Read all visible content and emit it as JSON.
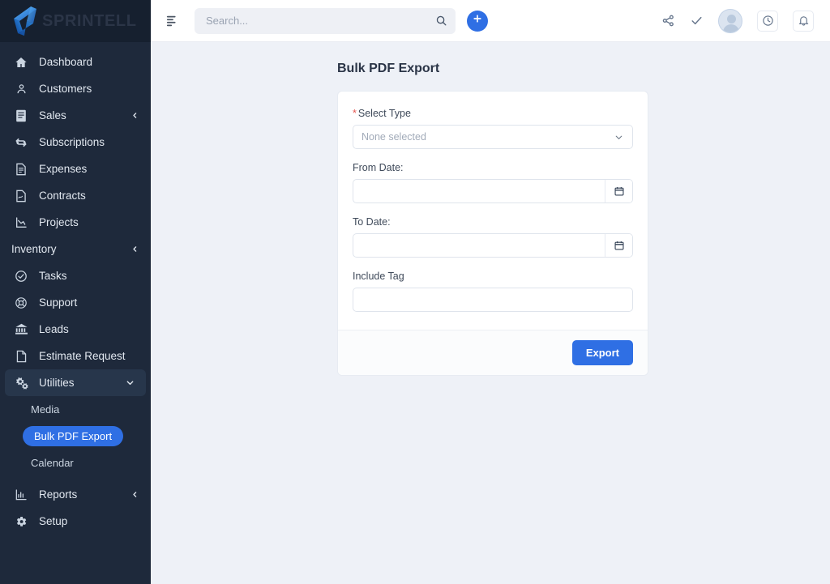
{
  "brand": {
    "name": "SPRINTELL",
    "logo_icon": "sprintell-s-logo-icon"
  },
  "sidebar": {
    "items": [
      {
        "label": "Dashboard",
        "icon": "home-icon",
        "has_icon": true,
        "chevron": ""
      },
      {
        "label": "Customers",
        "icon": "user-icon",
        "has_icon": true,
        "chevron": ""
      },
      {
        "label": "Sales",
        "icon": "receipt-icon",
        "has_icon": true,
        "chevron": "left"
      },
      {
        "label": "Subscriptions",
        "icon": "refresh-cycle-icon",
        "has_icon": true,
        "chevron": ""
      },
      {
        "label": "Expenses",
        "icon": "document-icon",
        "has_icon": true,
        "chevron": ""
      },
      {
        "label": "Contracts",
        "icon": "contract-icon",
        "has_icon": true,
        "chevron": ""
      },
      {
        "label": "Projects",
        "icon": "chart-decline-icon",
        "has_icon": true,
        "chevron": ""
      },
      {
        "label": "Inventory",
        "icon": "",
        "has_icon": false,
        "chevron": "left"
      },
      {
        "label": "Tasks",
        "icon": "check-circle-icon",
        "has_icon": true,
        "chevron": ""
      },
      {
        "label": "Support",
        "icon": "life-ring-icon",
        "has_icon": true,
        "chevron": ""
      },
      {
        "label": "Leads",
        "icon": "bank-icon",
        "has_icon": true,
        "chevron": ""
      },
      {
        "label": "Estimate Request",
        "icon": "file-icon",
        "has_icon": true,
        "chevron": ""
      }
    ],
    "utilities": {
      "label": "Utilities",
      "icon": "gears-icon",
      "chevron": "down",
      "expanded": true,
      "children": [
        {
          "label": "Media",
          "active": false
        },
        {
          "label": "Bulk PDF Export",
          "active": true
        },
        {
          "label": "Calendar",
          "active": false
        }
      ]
    },
    "items_after": [
      {
        "label": "Reports",
        "icon": "bar-chart-icon",
        "has_icon": true,
        "chevron": "left"
      },
      {
        "label": "Setup",
        "icon": "gear-icon",
        "has_icon": true,
        "chevron": ""
      }
    ],
    "active_color": "#2f6fe4",
    "background_color": "#1e293b"
  },
  "topbar": {
    "menu_toggle_icon": "menu-list-icon",
    "search": {
      "placeholder": "Search...",
      "value": "",
      "icon": "search-icon"
    },
    "add_button": {
      "label": "+",
      "icon": "plus-icon"
    },
    "actions": [
      {
        "icon": "share-icon",
        "name": "share-button"
      },
      {
        "icon": "check-icon",
        "name": "check-button"
      },
      {
        "icon": "avatar",
        "name": "user-avatar"
      },
      {
        "icon": "clock-icon",
        "name": "activity-button"
      },
      {
        "icon": "bell-icon",
        "name": "notifications-button"
      }
    ]
  },
  "main": {
    "page_title": "Bulk PDF Export",
    "form": {
      "select_type": {
        "label": "Select Type",
        "required": true,
        "required_marker": "*",
        "value": "None selected",
        "caret_icon": "chevron-down-icon"
      },
      "from_date": {
        "label": "From Date:",
        "value": "",
        "picker_icon": "calendar-icon"
      },
      "to_date": {
        "label": "To Date:",
        "value": "",
        "picker_icon": "calendar-icon"
      },
      "include_tag": {
        "label": "Include Tag",
        "value": "",
        "placeholder": ""
      }
    },
    "export_button": {
      "label": "Export",
      "color": "#2f6fe4"
    }
  }
}
